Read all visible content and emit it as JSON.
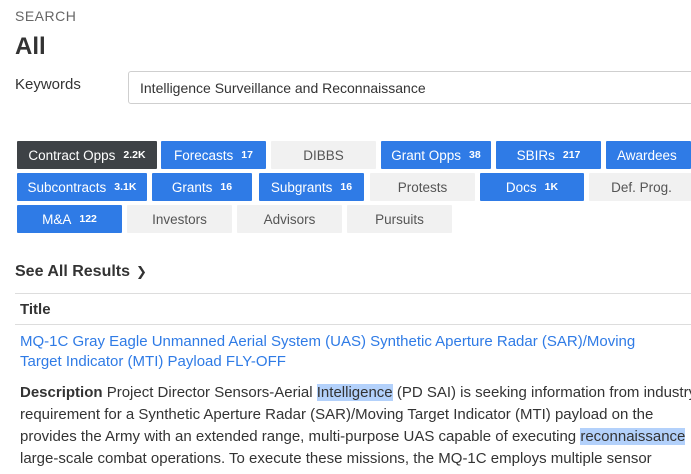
{
  "header": {
    "eyebrow": "SEARCH",
    "title": "All",
    "keywords_label": "Keywords",
    "keywords_value": "Intelligence Surveillance and Reconnaissance"
  },
  "chips": [
    {
      "label": "Contract Opps",
      "count": "2.2K",
      "style": "dark"
    },
    {
      "label": "Forecasts",
      "count": "17",
      "style": "blue"
    },
    {
      "label": "DIBBS",
      "count": "",
      "style": "grey"
    },
    {
      "label": "Grant Opps",
      "count": "38",
      "style": "blue"
    },
    {
      "label": "SBIRs",
      "count": "217",
      "style": "blue"
    },
    {
      "label": "Awardees",
      "count": "",
      "style": "blue"
    },
    {
      "label": "Subcontracts",
      "count": "3.1K",
      "style": "blue"
    },
    {
      "label": "Grants",
      "count": "16",
      "style": "blue"
    },
    {
      "label": "Subgrants",
      "count": "16",
      "style": "blue"
    },
    {
      "label": "Protests",
      "count": "",
      "style": "grey"
    },
    {
      "label": "Docs",
      "count": "1K",
      "style": "blue"
    },
    {
      "label": "Def. Prog.",
      "count": "",
      "style": "grey"
    },
    {
      "label": "M&A",
      "count": "122",
      "style": "blue"
    },
    {
      "label": "Investors",
      "count": "",
      "style": "grey"
    },
    {
      "label": "Advisors",
      "count": "",
      "style": "grey"
    },
    {
      "label": "Pursuits",
      "count": "",
      "style": "grey"
    }
  ],
  "see_all": "See All Results",
  "table": {
    "column_title": "Title",
    "result": {
      "title_line1": "MQ-1C Gray Eagle Unmanned Aerial System (UAS) Synthetic Aperture Radar (SAR)/Moving",
      "title_line2": "Target Indicator (MTI) Payload FLY-OFF",
      "desc_label": "Description",
      "desc_l1_a": "Project Director Sensors-Aerial",
      "desc_l1_hl": "Intelligence",
      "desc_l1_b": "(PD SAI) is seeking information from industry",
      "desc_l2": "requirement for a Synthetic Aperture Radar (SAR)/Moving Target Indicator (MTI) payload on the",
      "desc_l3_a": "provides the Army with an extended range, multi-purpose UAS capable of executing",
      "desc_l3_hl": "reconnaissance",
      "desc_l4": "large-scale combat operations. To execute these missions, the MQ-1C employs multiple sensor"
    }
  },
  "colors": {
    "accent": "#2f7be6",
    "dark_chip": "#3e4246",
    "grey_chip": "#f1f1f1",
    "highlight": "#b3d1fb"
  }
}
